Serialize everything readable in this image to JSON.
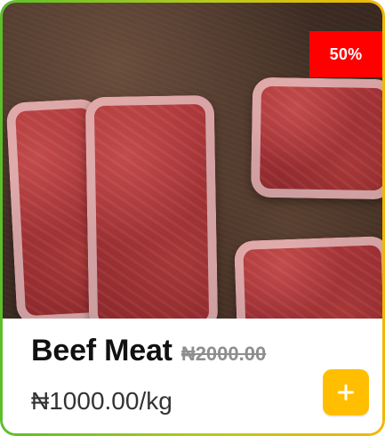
{
  "product_card": {
    "badge": {
      "label": "50%",
      "color": "#ff0000"
    },
    "image": {
      "alt": "Beef Meat"
    },
    "title": "Beef Meat",
    "old_price": "₦2000.00",
    "new_price": "₦1000.00",
    "unit": "/kg",
    "add_button": {
      "icon": "plus-icon",
      "color": "#ffbf00"
    },
    "border_gradient": [
      "#5bbf2a",
      "#b8c91d",
      "#f2b705"
    ]
  }
}
